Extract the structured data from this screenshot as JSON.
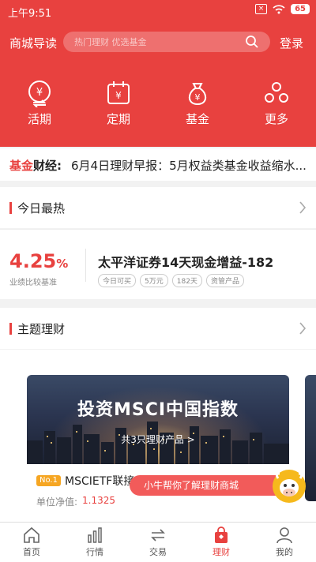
{
  "status_bar": {
    "time": "上午9:51",
    "battery": "65"
  },
  "header": {
    "guide_label": "商城导读",
    "search_placeholder": "热门理财  优选基金",
    "login_label": "登录"
  },
  "quick_menu": [
    {
      "label": "活期",
      "icon": "currency-transfer-icon"
    },
    {
      "label": "定期",
      "icon": "calendar-yen-icon"
    },
    {
      "label": "基金",
      "icon": "money-bag-icon"
    },
    {
      "label": "更多",
      "icon": "more-circles-icon"
    }
  ],
  "news": {
    "tag_part1": "基金",
    "tag_part2": "财经:",
    "text": "6月4日理财早报：5月权益类基金收益缩水..."
  },
  "today_hot": {
    "title": "今日最热",
    "rate_value": "4.25",
    "rate_unit": "%",
    "rate_label": "业绩比较基准",
    "product_name": "太平洋证券14天现金增益-182",
    "tags": [
      "今日可买",
      "5万元",
      "182天",
      "资管产品"
    ]
  },
  "theme": {
    "title": "主题理财",
    "banner_title": "投资MSCI中国指数",
    "banner_subtitle": "共3只理财产品 >",
    "badge": "No.1",
    "fund_name": "MSCIETF联接",
    "nav_label": "单位净值:",
    "nav_value": "1.1325"
  },
  "assistant": {
    "bubble_text": "小牛帮你了解理财商城"
  },
  "tabbar": [
    {
      "label": "首页",
      "icon": "home-icon",
      "active": false
    },
    {
      "label": "行情",
      "icon": "chart-icon",
      "active": false
    },
    {
      "label": "交易",
      "icon": "exchange-icon",
      "active": false
    },
    {
      "label": "理财",
      "icon": "wealth-bag-icon",
      "active": true
    },
    {
      "label": "我的",
      "icon": "user-icon",
      "active": false
    }
  ],
  "colors": {
    "accent": "#e8413f",
    "badge": "#f6a623"
  }
}
